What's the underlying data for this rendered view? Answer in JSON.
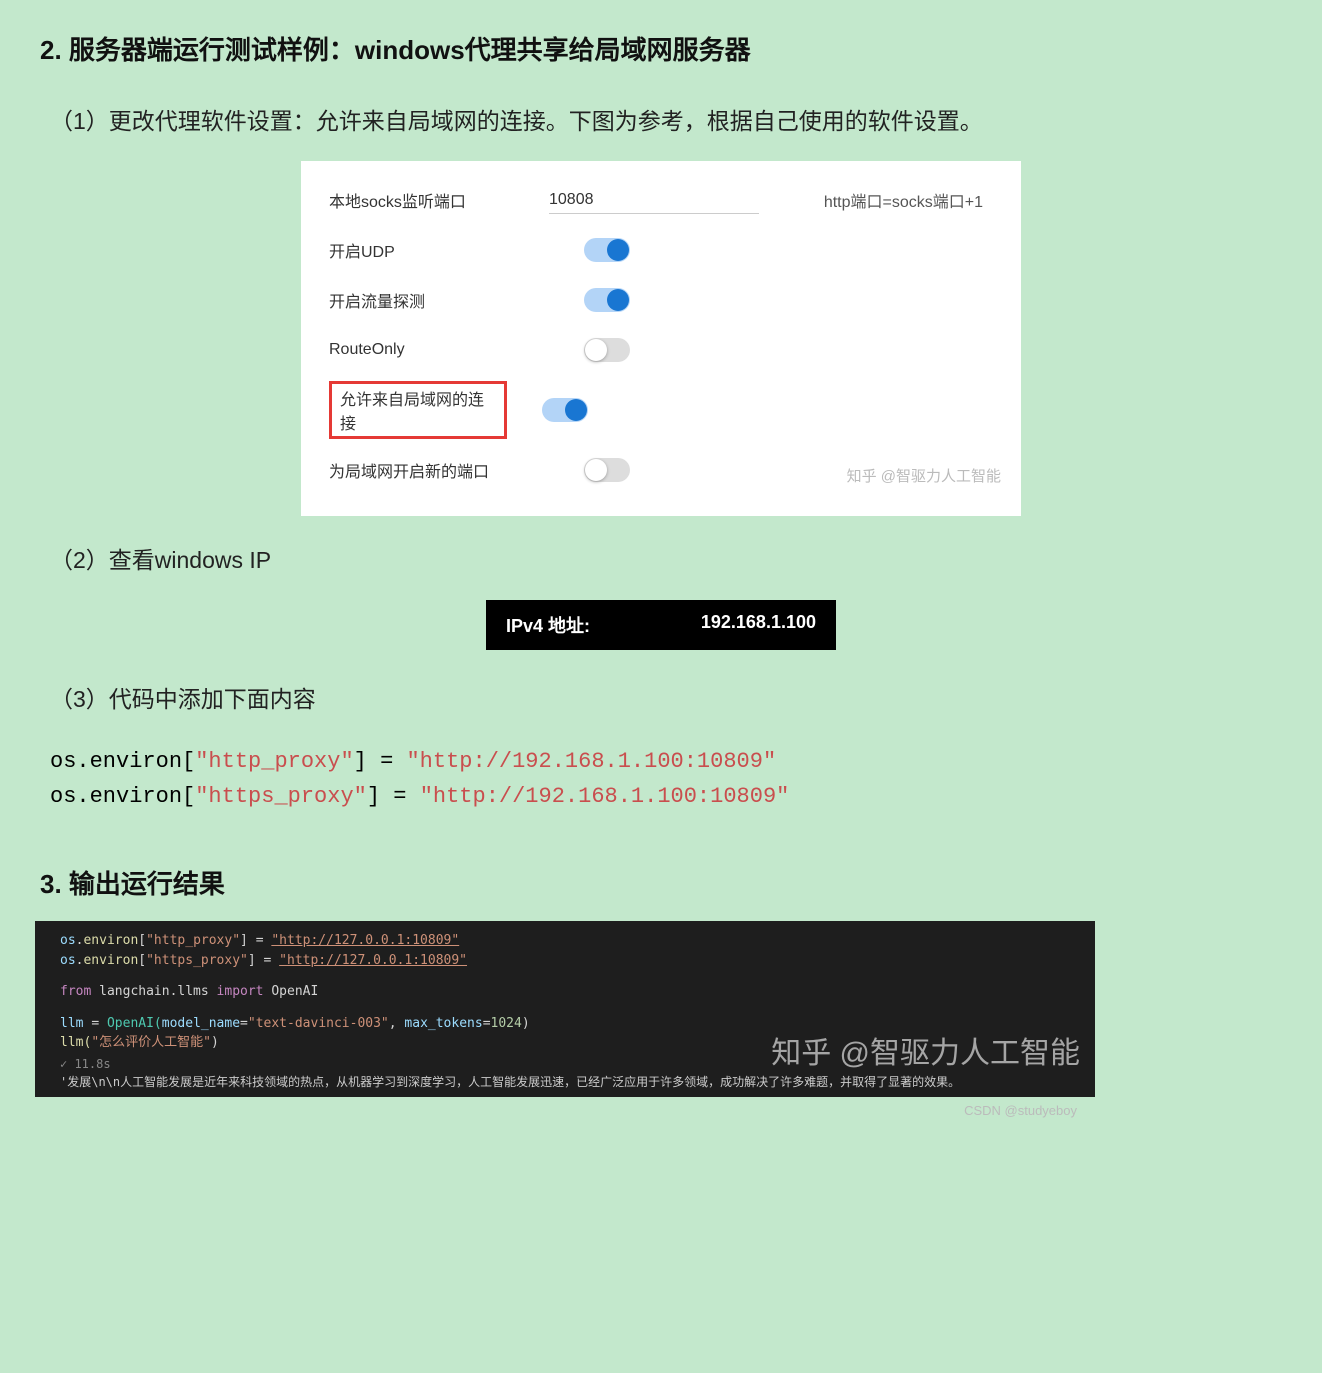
{
  "heading2": "2. 服务器端运行测试样例：windows代理共享给局域网服务器",
  "step1": "（1）更改代理软件设置：允许来自局域网的连接。下图为参考，根据自己使用的软件设置。",
  "settings": {
    "rows": [
      {
        "label": "本地socks监听端口",
        "value": "10808",
        "hint": "http端口=socks端口+1",
        "type": "field"
      },
      {
        "label": "开启UDP",
        "type": "toggle",
        "on": true
      },
      {
        "label": "开启流量探测",
        "type": "toggle",
        "on": true
      },
      {
        "label": "RouteOnly",
        "type": "toggle",
        "on": false
      },
      {
        "label": "允许来自局域网的连接",
        "type": "toggle",
        "on": true,
        "highlight": true
      },
      {
        "label": "为局域网开启新的端口",
        "type": "toggle",
        "on": false
      }
    ],
    "watermark": "知乎 @智驱力人工智能"
  },
  "step2": "（2）查看windows IP",
  "ipbox": {
    "label": "IPv4 地址:",
    "value": "192.168.1.100"
  },
  "step3": "（3）代码中添加下面内容",
  "code1": {
    "p1": "os.environ[",
    "s1": "\"http_proxy\"",
    "p2": "] = ",
    "s2": "\"http://192.168.1.100:10809\""
  },
  "code2": {
    "p1": "os.environ[",
    "s1": "\"https_proxy\"",
    "p2": "] = ",
    "s2": "\"http://192.168.1.100:10809\""
  },
  "heading3": "3. 输出运行结果",
  "terminal": {
    "l1": {
      "a": "os",
      "b": ".",
      "c": "environ",
      "d": "[",
      "e": "\"http_proxy\"",
      "f": "] ",
      "g": "=",
      "h": " ",
      "i": "\"http://127.0.0.1:10809\""
    },
    "l2": {
      "a": "os",
      "b": ".",
      "c": "environ",
      "d": "[",
      "e": "\"https_proxy\"",
      "f": "] ",
      "g": "=",
      "h": " ",
      "i": "\"http://127.0.0.1:10809\""
    },
    "l3": {
      "a": "from",
      "b": " langchain.llms ",
      "c": "import",
      "d": " OpenAI"
    },
    "l4": {
      "a": "llm ",
      "b": "=",
      "c": " OpenAI(",
      "d": "model_name",
      "e": "=",
      "f": "\"text-davinci-003\"",
      "g": ", ",
      "h": "max_tokens",
      "i": "=",
      "j": "1024",
      "k": ")"
    },
    "l5": {
      "a": "llm(",
      "b": "\"怎么评价人工智能\"",
      "c": ")"
    },
    "time": "✓   11.8s",
    "output": "'发展\\n\\n人工智能发展是近年来科技领域的热点，从机器学习到深度学习，人工智能发展迅速，已经广泛应用于许多领域，成功解决了许多难题，并取得了显著的效果。",
    "watermark": "知乎 @智驱力人工智能"
  },
  "footer": "CSDN @studyeboy"
}
